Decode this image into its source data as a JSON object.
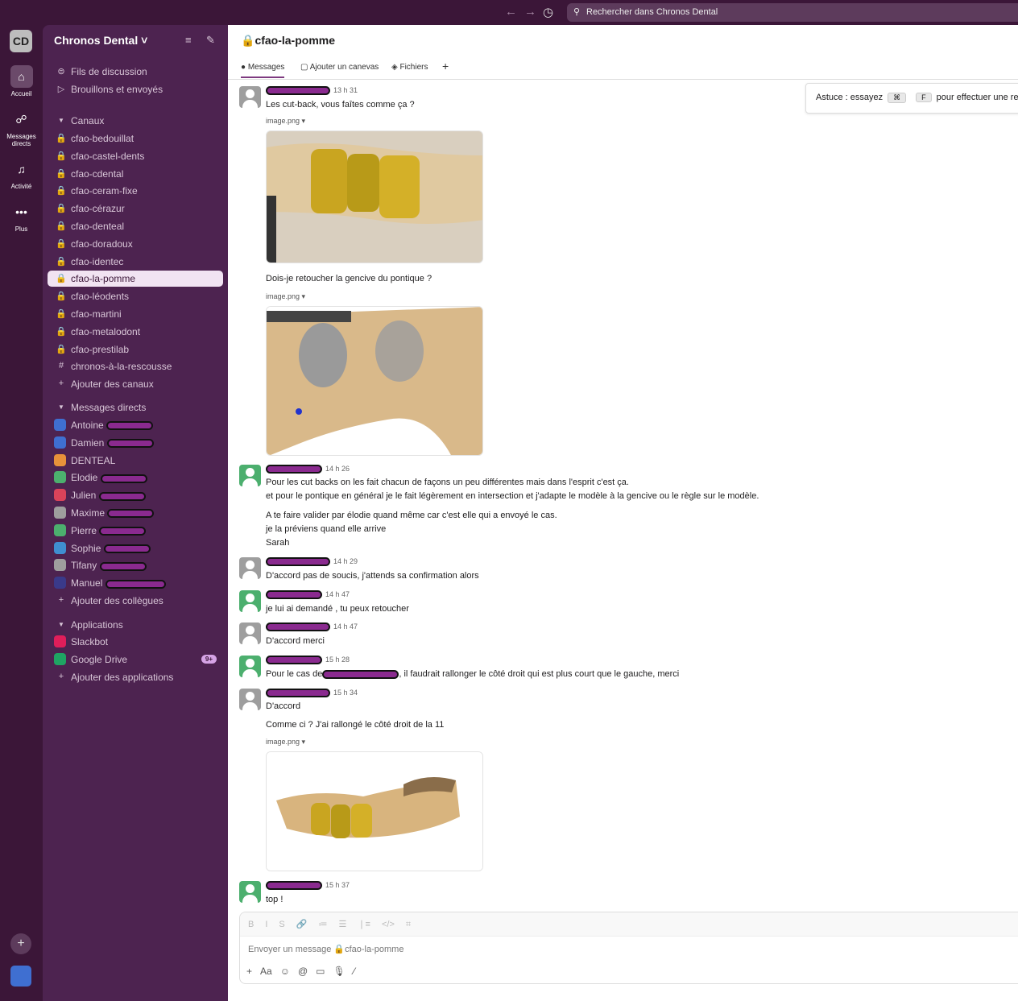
{
  "topbar": {
    "back_icon": "arrow-left-icon",
    "forward_icon": "arrow-right-icon",
    "history_icon": "clock-icon",
    "search_placeholder": "Rechercher dans Chronos Dental"
  },
  "rail": {
    "workspace_initials": "CD",
    "items": [
      {
        "label": "Accueil",
        "icon": "home-icon"
      },
      {
        "label": "Messages directs",
        "icon": "dm-icon"
      },
      {
        "label": "Activité",
        "icon": "bell-icon"
      },
      {
        "label": "Plus",
        "icon": "more-icon"
      }
    ]
  },
  "sidebar": {
    "workspace": "Chronos Dental",
    "top_items": [
      {
        "label": "Fils de discussion",
        "icon": "threads-icon"
      },
      {
        "label": "Brouillons et envoyés",
        "icon": "send-icon"
      }
    ],
    "channels_header": "Canaux",
    "channels": [
      "cfao-bedouillat",
      "cfao-castel-dents",
      "cfao-cdental",
      "cfao-ceram-fixe",
      "cfao-cérazur",
      "cfao-denteal",
      "cfao-doradoux",
      "cfao-identec",
      "cfao-la-pomme",
      "cfao-léodents",
      "cfao-martini",
      "cfao-metalodont",
      "cfao-prestilab",
      "chronos-à-la-rescousse"
    ],
    "active_channel": "cfao-la-pomme",
    "add_channels": "Ajouter des canaux",
    "dm_header": "Messages directs",
    "dms": [
      {
        "name": "Antoine",
        "color": "#3f6fd1"
      },
      {
        "name": "Damien",
        "color": "#3f6fd1"
      },
      {
        "name": "DENTEAL",
        "color": "#e8913a"
      },
      {
        "name": "Elodie",
        "color": "#4caf6e"
      },
      {
        "name": "Julien",
        "color": "#d9435a"
      },
      {
        "name": "Maxime",
        "color": "#9e9e9e"
      },
      {
        "name": "Pierre",
        "color": "#4caf6e"
      },
      {
        "name": "Sophie",
        "color": "#3f8fd1"
      },
      {
        "name": "Tifany",
        "color": "#9e9e9e"
      },
      {
        "name": "Manuel",
        "color": "#3a3a8a"
      }
    ],
    "add_colleagues": "Ajouter des collègues",
    "apps_header": "Applications",
    "apps": [
      {
        "name": "Slackbot",
        "color": "#e01e5a"
      },
      {
        "name": "Google Drive",
        "color": "#1fa463",
        "badge": "9+"
      }
    ],
    "add_apps": "Ajouter des applications"
  },
  "channel": {
    "title": "cfao-la-pomme",
    "tabs": [
      "Messages",
      "Ajouter un canevas",
      "Fichiers"
    ],
    "add_tab": "+"
  },
  "tip": {
    "prefix": "Astuce : essayez",
    "key1": "⌘",
    "key2": "F",
    "suffix": "pour effectuer une re"
  },
  "messages": [
    {
      "time": "13 h 31",
      "avatar": "grey",
      "lines": [
        "Les cut-back,  vous faîtes comme ça ?"
      ],
      "file": "image.png ▾",
      "lines2": [
        "Dois-je retoucher la gencive du pontique ?"
      ],
      "file2": "image.png ▾"
    },
    {
      "time": "14 h 26",
      "avatar": "green",
      "lines": [
        "Pour les cut backs on les fait chacun de façons un peu différentes mais dans l'esprit c'est ça.",
        "et pour le pontique en général je le fait légèrement en intersection et j'adapte le modèle à la gencive ou le règle sur le modèle."
      ],
      "lines2": [
        "A te faire valider par élodie quand même car c'est elle qui a envoyé le cas.",
        "je la préviens quand elle arrive",
        "Sarah"
      ]
    },
    {
      "time": "14 h 29",
      "avatar": "grey",
      "lines": [
        "D'accord pas de soucis, j'attends sa confirmation alors"
      ]
    },
    {
      "time": "14 h 47",
      "avatar": "green",
      "lines": [
        "je lui ai demandé , tu peux retoucher"
      ]
    },
    {
      "time": "14 h 47",
      "avatar": "grey",
      "lines": [
        "D'accord merci"
      ]
    },
    {
      "time": "15 h 28",
      "avatar": "green",
      "text_before": "Pour le cas de",
      "text_after": ", il faudrait rallonger le côté droit qui est plus court que le gauche, merci"
    },
    {
      "time": "15 h 34",
      "avatar": "grey",
      "lines": [
        "D'accord"
      ],
      "lines2": [
        "Comme ci ? J'ai rallongé le côté droit de la 11"
      ],
      "file": "image.png ▾"
    },
    {
      "time": "15 h 37",
      "avatar": "green",
      "lines": [
        "top !"
      ]
    }
  ],
  "composer": {
    "placeholder": "Envoyer un message 🔒cfao-la-pomme",
    "format": [
      "B",
      "I",
      "S",
      "🔗",
      "≔",
      "☰",
      "❘≡",
      "</>",
      "⌗"
    ],
    "actions": [
      "+",
      "Aa",
      "☺",
      "@",
      "▭",
      "🎙",
      "⁄"
    ]
  }
}
